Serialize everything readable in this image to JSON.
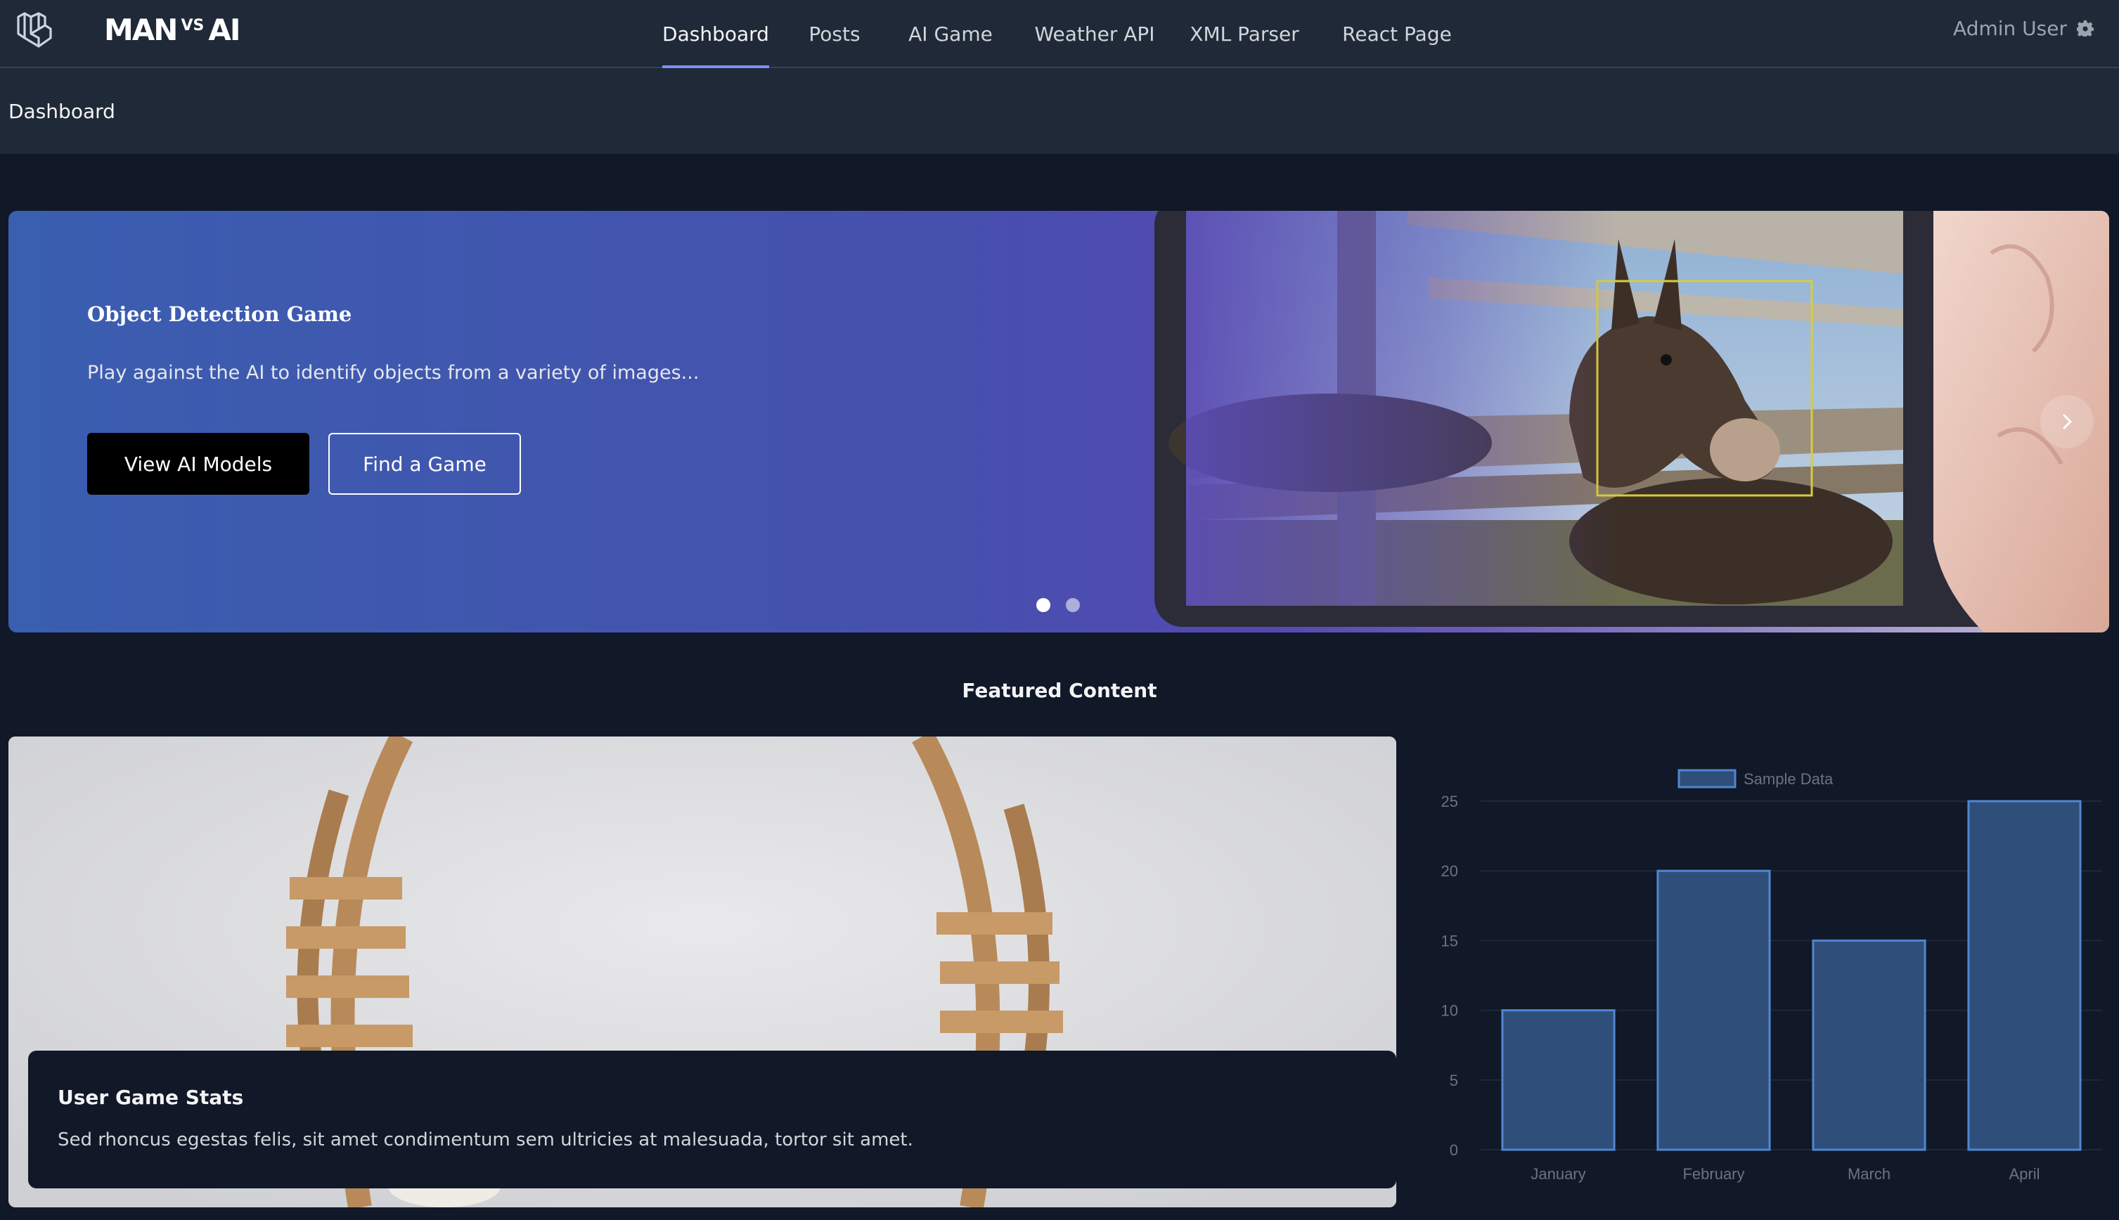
{
  "app": {
    "brand_left": "MAN",
    "brand_vs": "VS",
    "brand_right": "AI"
  },
  "nav": {
    "items": [
      {
        "label": "Dashboard",
        "active": true
      },
      {
        "label": "Posts",
        "active": false
      },
      {
        "label": "AI Game",
        "active": false
      },
      {
        "label": "Weather API",
        "active": false
      },
      {
        "label": "XML Parser",
        "active": false
      },
      {
        "label": "React Page",
        "active": false
      }
    ],
    "user_label": "Admin User",
    "user_icon": "gear-icon"
  },
  "header": {
    "title": "Dashboard"
  },
  "hero": {
    "title": "Object Detection Game",
    "description": "Play against the AI to identify objects from a variety of images...",
    "primary_button": "View AI Models",
    "secondary_button": "Find a Game",
    "slide_count": 2,
    "active_slide": 1,
    "image_subject": "donkey-behind-fence-with-detection-box"
  },
  "featured": {
    "title": "Featured Content",
    "card": {
      "title": "User Game Stats",
      "text": "Sed rhoncus egestas felis, sit amet condimentum sem ultricies at malesuada, tortor sit amet."
    }
  },
  "chart_data": {
    "type": "bar",
    "categories": [
      "January",
      "February",
      "March",
      "April"
    ],
    "series": [
      {
        "name": "Sample Data",
        "values": [
          10,
          20,
          15,
          25
        ]
      }
    ],
    "ylim": [
      0,
      25
    ],
    "yticks": [
      0,
      5,
      10,
      15,
      20,
      25
    ],
    "legend": "top-center",
    "grid": true,
    "colors": {
      "bar_fill": "#2f4f7a",
      "bar_stroke": "#4f86d0"
    }
  },
  "colors": {
    "accent": "#818cf8",
    "nav_bg": "#1f2937",
    "page_bg": "#111827"
  }
}
